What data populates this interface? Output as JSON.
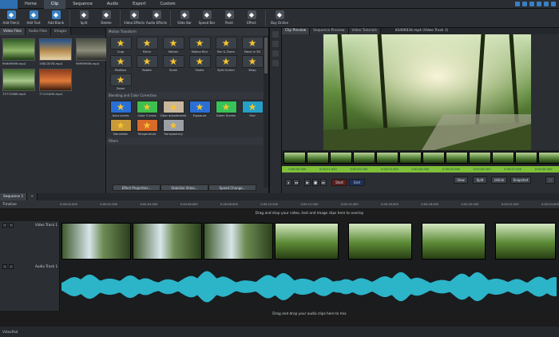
{
  "menubar": {
    "items": [
      "Home",
      "Clip",
      "Sequence",
      "Audio",
      "Export",
      "Custom"
    ],
    "active": "Clip"
  },
  "ribbon": {
    "buttons": [
      {
        "label": "Add File(s)",
        "icon": "add-file-icon",
        "color": "#3b82c4"
      },
      {
        "label": "Add Text",
        "icon": "text-icon",
        "color": "#3b82c4"
      },
      {
        "label": "Add Blank",
        "icon": "blank-clip-icon",
        "color": "#3b82c4"
      },
      {
        "label": "Split",
        "icon": "scissors-icon",
        "color": "#4a5058"
      },
      {
        "label": "Delete",
        "icon": "delete-icon",
        "color": "#4a5058"
      },
      {
        "label": "Video Effects",
        "icon": "video-effects-icon",
        "color": "#4a5058"
      },
      {
        "label": "Audio Effects",
        "icon": "audio-effects-icon",
        "color": "#4a5058"
      },
      {
        "label": "Slide Bar",
        "icon": "slide-bar-icon",
        "color": "#4a5058"
      },
      {
        "label": "Speed Bar",
        "icon": "speed-icon",
        "color": "#4a5058"
      },
      {
        "label": "Paint",
        "icon": "brush-icon",
        "color": "#4a5058"
      },
      {
        "label": "Effect",
        "icon": "magic-icon",
        "color": "#4a5058"
      },
      {
        "label": "Buy Online",
        "icon": "cart-icon",
        "color": "#4a5058"
      }
    ]
  },
  "media": {
    "tabs": [
      "Video Files",
      "Audio Files",
      "Images"
    ],
    "files": [
      {
        "name": "99999999.mp4",
        "colors": [
          "#2f5a23",
          "#8fb56a",
          "#1d3b14"
        ]
      },
      {
        "name": "19813076.mp4",
        "colors": [
          "#1e4f8f",
          "#b48a4e",
          "#e6d4a8"
        ]
      },
      {
        "name": "99999999.mp4",
        "colors": [
          "#4b4f44",
          "#8d8d7a",
          "#2b2c27"
        ]
      },
      {
        "name": "75772969.mp4",
        "colors": [
          "#3d6b2a",
          "#a7c68a",
          "#213e12"
        ]
      },
      {
        "name": "77121845.mp4",
        "colors": [
          "#8c3a1c",
          "#e07a3a",
          "#3a1b0d"
        ]
      }
    ]
  },
  "effects": {
    "section_transform": "Motion Transform",
    "transform": [
      "Crop",
      "Mirror",
      "Motion",
      "Motion Blur",
      "Pan & Zoom",
      "Move in 3D",
      "Position",
      "Rotate",
      "Scale",
      "Shake",
      "Split Screen",
      "Wrap",
      "Zoom"
    ],
    "section_color": "Blending and Color Correction",
    "color": [
      "Auto Levels",
      "Color Curves",
      "Color adjustments",
      "Exposure",
      "Green Screen",
      "Hue",
      "Saturation",
      "Temperature",
      "Transparency"
    ],
    "section_filters": "Filters",
    "buttons": [
      "Effect Properties...",
      "Stabilize Video...",
      "Speed Change..."
    ]
  },
  "preview": {
    "tabs": [
      "Clip Preview",
      "Sequence Preview",
      "Video Tutorials"
    ],
    "title": "83406034.mp4 (Video Track 1)",
    "timecodes": [
      "0:00:00.000",
      "0:00:01.000",
      "0:00:02.000",
      "0:00:03.000",
      "0:00:04.000",
      "0:00:05.000",
      "0:00:06.000",
      "0:00:07.000",
      "0:00:08.000"
    ],
    "controls": {
      "start": "Start",
      "end": "End",
      "view": "View",
      "split": "Split",
      "unlink": "Unlink",
      "snapshot": "Snapshot"
    }
  },
  "sequence": {
    "tab": "Sequence 1",
    "timeline_label": "Timeline",
    "ruler": [
      "0:00:00.000",
      "0:00:02.000",
      "0:00:04.000",
      "0:00:06.000",
      "0:00:08.000",
      "0:00:10.000",
      "0:00:12.000",
      "0:00:14.000",
      "0:00:16.000",
      "0:00:18.000",
      "0:00:20.000",
      "0:00:22.000",
      "0:00:24.000"
    ],
    "overlay_hint": "Drag and drop your video, text and image clips here to overlay",
    "video_track": "Video Track 1",
    "audio_track": "Audio Track 1",
    "audio_hint": "Drag and drop your audio clips here to mix",
    "wave_color": "#2cb4c9"
  },
  "status": {
    "text": "VideoPad"
  }
}
